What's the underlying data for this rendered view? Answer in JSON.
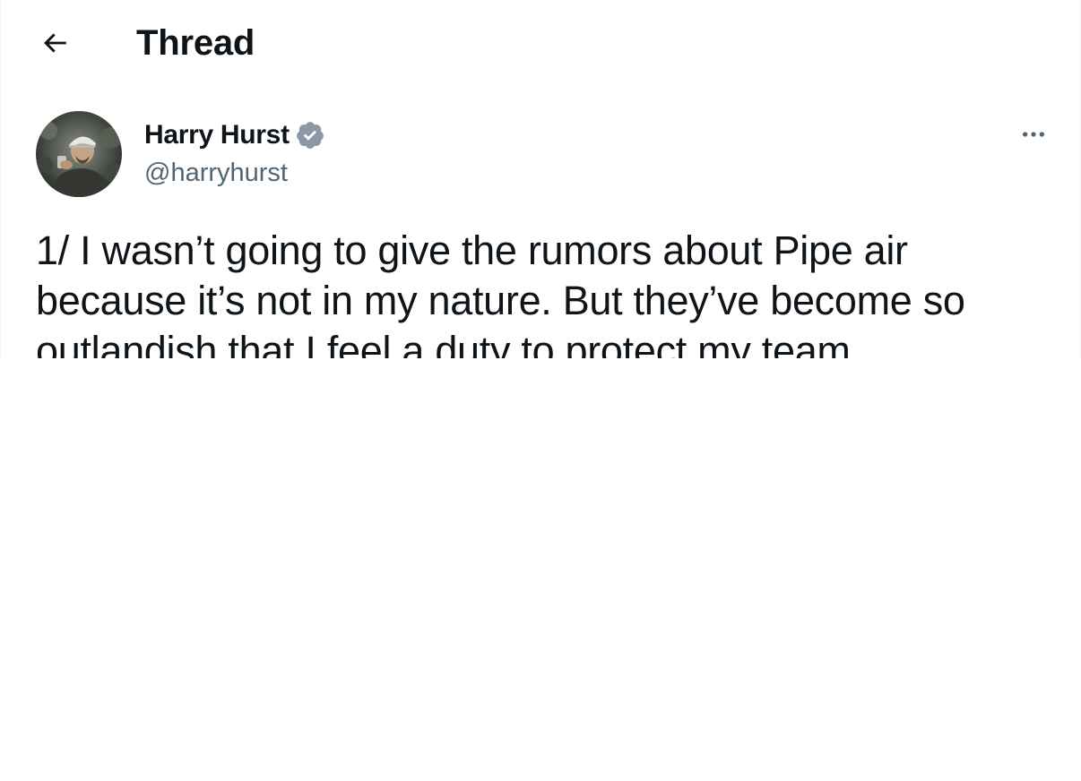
{
  "header": {
    "back_icon": "arrow-left-icon",
    "title": "Thread"
  },
  "tweet": {
    "author": {
      "display_name": "Harry Hurst",
      "handle": "@harryhurst",
      "verified_icon": "verified-badge-icon",
      "avatar_icon": "avatar-photo"
    },
    "more_icon": "more-horizontal-icon",
    "text_lines": [
      "1/ I wasn’t going to give the rumors about Pipe air",
      "because it’s not in my nature. But they’ve become so",
      "outlandish that I feel a duty to protect my team"
    ]
  },
  "colors": {
    "text_primary": "#0f1419",
    "text_secondary": "#536471",
    "verified_badge": "#8b98a5",
    "border": "#eff3f4"
  }
}
